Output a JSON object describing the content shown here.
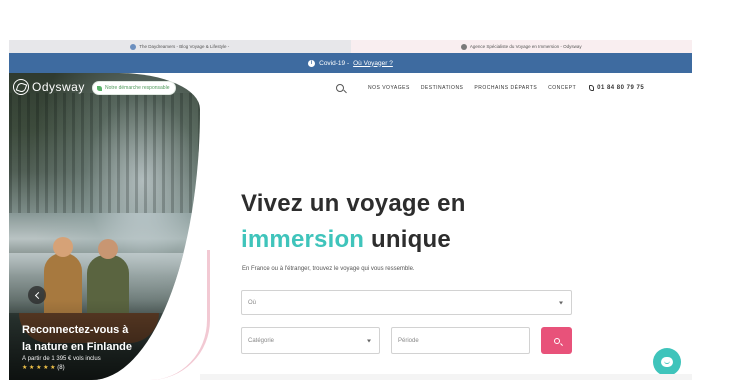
{
  "browser": {
    "tabs": [
      {
        "label": "The Daydreamers - Blog Voyage & Lifestyle -"
      },
      {
        "label": "Agence Spécialiste du Voyage en Immersion - Odysway"
      }
    ]
  },
  "banner": {
    "text": "Covid-19 -",
    "link": "Où Voyager ?",
    "color": "#3e6ba0"
  },
  "header": {
    "logo": "Odysway",
    "eco_badge": "Notre démarche responsable",
    "nav": [
      "NOS VOYAGES",
      "DESTINATIONS",
      "PROCHAINS DÉPARTS",
      "CONCEPT"
    ],
    "phone": "01 84 80 79 75"
  },
  "hero": {
    "headline_line1": "Vivez un voyage en",
    "headline_accent": "immersion",
    "headline_rest": " unique",
    "subtitle": "En France ou à l'étranger, trouvez le voyage qui vous ressemble.",
    "accent_color": "#3fc4bb"
  },
  "search_form": {
    "where_placeholder": "Où",
    "category_placeholder": "Catégorie",
    "period_placeholder": "Période",
    "button_color": "#e8527a"
  },
  "featured_trip": {
    "title_line1": "Reconnectez-vous à",
    "title_line2": "la nature en Finlande",
    "price": "À partir de 1 395 € vols inclus",
    "stars": "★ ★ ★ ★ ★",
    "reviews": "(8)"
  },
  "icons": {
    "search": "search-icon",
    "phone": "phone-icon",
    "chat": "chat-icon",
    "arrow": "chevron-left-icon"
  }
}
